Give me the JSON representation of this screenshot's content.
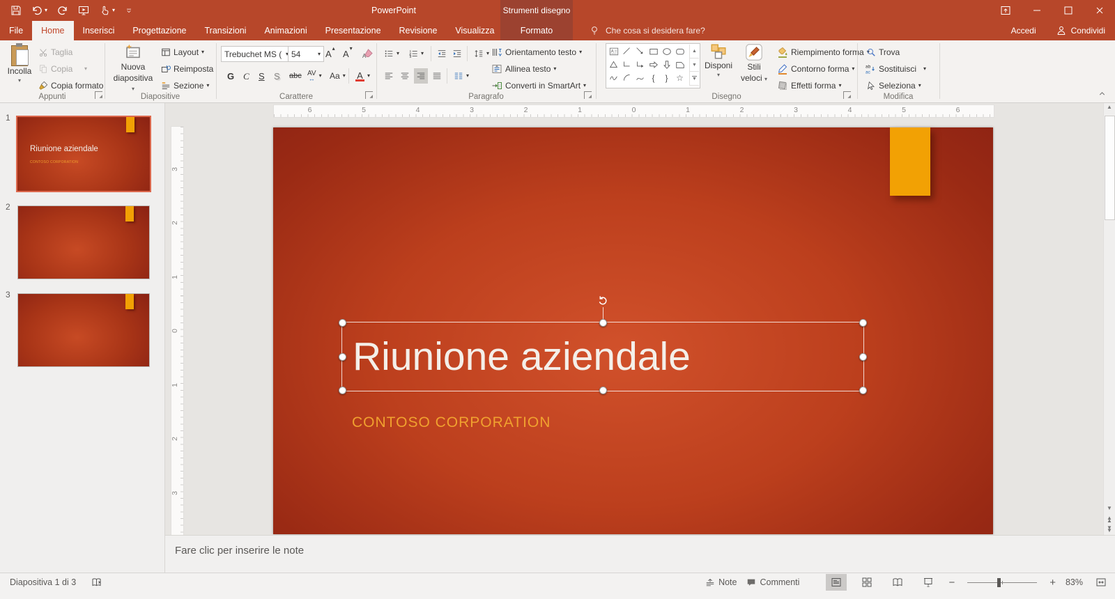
{
  "titlebar": {
    "app_title": "PowerPoint",
    "contextual_group": "Strumenti disegno"
  },
  "tabs": {
    "file": "File",
    "home": "Home",
    "insert": "Inserisci",
    "design": "Progettazione",
    "transitions": "Transizioni",
    "animations": "Animazioni",
    "slideshow": "Presentazione",
    "review": "Revisione",
    "view": "Visualizza",
    "format": "Formato"
  },
  "tellme": {
    "placeholder": "Che cosa si desidera fare?"
  },
  "account": {
    "sign_in": "Accedi",
    "share": "Condividi"
  },
  "ribbon": {
    "clipboard": {
      "label": "Appunti",
      "paste": "Incolla",
      "cut": "Taglia",
      "copy": "Copia",
      "format_painter": "Copia formato"
    },
    "slides": {
      "label": "Diapositive",
      "new_slide_line1": "Nuova",
      "new_slide_line2": "diapositiva",
      "layout": "Layout",
      "reset": "Reimposta",
      "section": "Sezione"
    },
    "font": {
      "label": "Carattere",
      "font_name": "Trebuchet MS (",
      "font_size": "54",
      "bold": "G",
      "italic": "C",
      "underline": "S",
      "shadow": "S",
      "strikethrough": "abc",
      "char_spacing": "AV",
      "change_case": "Aa",
      "font_color": "A"
    },
    "paragraph": {
      "label": "Paragrafo",
      "text_direction": "Orientamento testo",
      "align_text": "Allinea testo",
      "smartart": "Converti in SmartArt"
    },
    "drawing": {
      "label": "Disegno",
      "arrange": "Disponi",
      "quick_styles_line1": "Stili",
      "quick_styles_line2": "veloci",
      "shape_fill": "Riempimento forma",
      "shape_outline": "Contorno forma",
      "shape_effects": "Effetti forma"
    },
    "editing": {
      "label": "Modifica",
      "find": "Trova",
      "replace": "Sostituisci",
      "select": "Seleziona"
    }
  },
  "slide_panel": {
    "slides": [
      {
        "number": "1",
        "title": "Riunione aziendale",
        "subtitle": "CONTOSO CORPORATION",
        "selected": true
      },
      {
        "number": "2",
        "selected": false
      },
      {
        "number": "3",
        "selected": false
      }
    ]
  },
  "canvas": {
    "title": "Riunione aziendale",
    "subtitle": "CONTOSO CORPORATION"
  },
  "rulers": {
    "horizontal": [
      "6",
      "5",
      "4",
      "3",
      "2",
      "1",
      "0",
      "1",
      "2",
      "3",
      "4",
      "5",
      "6"
    ],
    "vertical": [
      "3",
      "2",
      "1",
      "0",
      "1",
      "2",
      "3"
    ]
  },
  "notes": {
    "placeholder": "Fare clic per inserire le note"
  },
  "statusbar": {
    "slide_indicator": "Diapositiva 1 di 3",
    "notes_toggle": "Note",
    "comments_toggle": "Commenti",
    "zoom_level": "83%"
  },
  "colors": {
    "titlebar": "#B7472A",
    "contextual_tab": "#9C4230",
    "accent_gold": "#F2A104",
    "slide_center": "#CE4E26",
    "slide_edge": "#8C2112",
    "subtitle_text": "#F0A12F"
  }
}
